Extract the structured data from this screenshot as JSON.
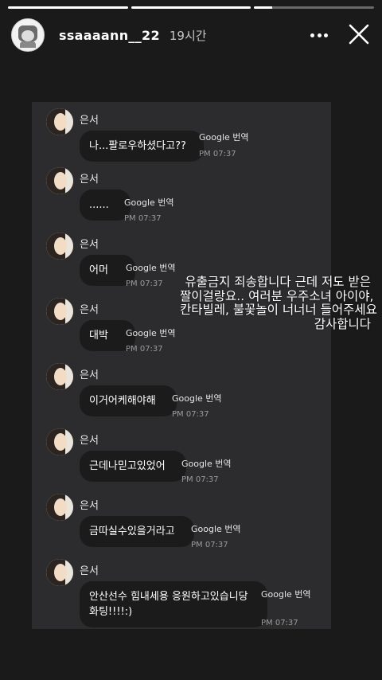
{
  "story": {
    "progress_segments": [
      {
        "filled_fraction": 1.0
      },
      {
        "filled_fraction": 1.0
      },
      {
        "filled_fraction": 0.15
      }
    ],
    "username": "ssaaaann__22",
    "time_ago": "19시간",
    "more_icon": "more-dots-icon",
    "close_icon": "close-icon"
  },
  "chat": {
    "translate_label": "Google 번역",
    "messages": [
      {
        "sender": "은서",
        "text": "나...팔로우하셨다고??",
        "time": "PM 07:37"
      },
      {
        "sender": "은서",
        "text": "......",
        "time": "PM 07:37"
      },
      {
        "sender": "은서",
        "text": "어머",
        "time": "PM 07:37"
      },
      {
        "sender": "은서",
        "text": "대박",
        "time": "PM 07:37"
      },
      {
        "sender": "은서",
        "text": "이거어케해야해",
        "time": "PM 07:37"
      },
      {
        "sender": "은서",
        "text": "근데나믿고있었어",
        "time": "PM 07:37"
      },
      {
        "sender": "은서",
        "text": "금따실수있을거라고",
        "time": "PM 07:37"
      },
      {
        "sender": "은서",
        "text": "안산선수 힘내세용 응원하고있습니당\n화팅!!!!:)",
        "time": "PM 07:37"
      }
    ]
  },
  "overlay_text": {
    "lines": [
      "유출금지 죄송합니다 근데 저도 받은",
      "짤이걸랑요.. 여러분 우주소녀 아이야,",
      "칸타빌레, 불꽃놀이 너너너 들어주세요",
      "감사합니다"
    ]
  }
}
